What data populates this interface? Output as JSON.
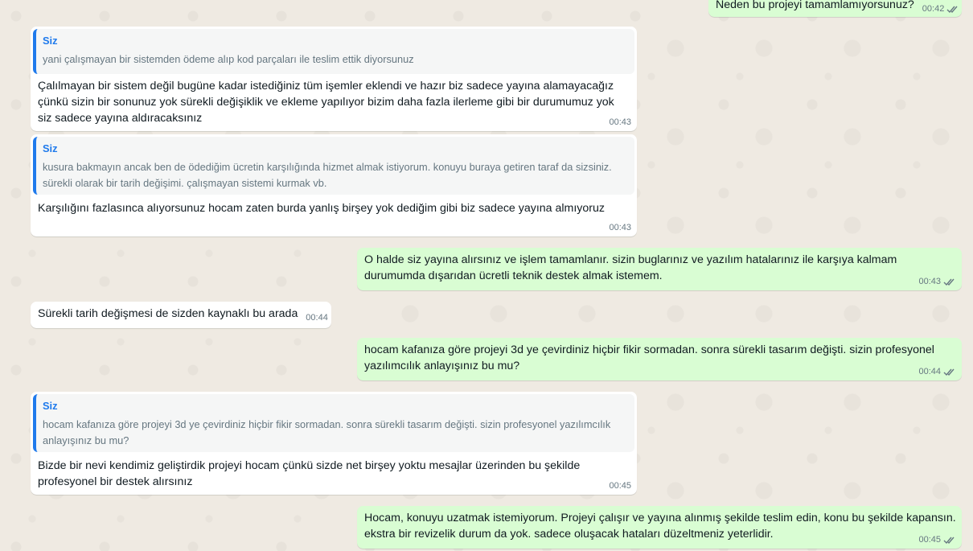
{
  "messages": [
    {
      "text": "Neden bu projeyi tamamlamıyorsunuz?",
      "time": "00:42"
    },
    {
      "quote_author": "Siz",
      "quote_text": "yani çalışmayan bir sistemden ödeme alıp kod parçaları ile teslim ettik diyorsunuz",
      "text": "Çalılmayan bir sistem değil bugüne kadar istediğiniz tüm işemler eklendi ve hazır biz sadece yayına alamayacağız çünkü sizin bir sonunuz yok sürekli değişiklik ve ekleme yapılıyor bizim daha fazla ilerleme gibi bir durumumuz yok siz sadece yayına aldıracaksınız",
      "time": "00:43"
    },
    {
      "quote_author": "Siz",
      "quote_text": "kusura bakmayın ancak ben de ödediğim ücretin  karşılığında hizmet almak istiyorum. konuyu buraya getiren taraf da sizsiniz. sürekli olarak bir tarih değişimi. çalışmayan sistemi kurmak vb.",
      "text": "Karşılığını fazlasınca alıyorsunuz hocam zaten burda yanlış birşey yok dediğim gibi biz sadece yayına almıyoruz",
      "time": "00:43"
    },
    {
      "text": "O halde siz yayına alırsınız ve işlem tamamlanır. sizin buglarınız ve yazılım hatalarınız ile karşıya kalmam durumumda dışarıdan ücretli teknik destek almak istemem.",
      "time": "00:43"
    },
    {
      "text": "Sürekli tarih değişmesi de sizden kaynaklı bu arada",
      "time": "00:44"
    },
    {
      "text": "hocam kafanıza göre projeyi 3d ye çevirdiniz hiçbir fikir sormadan. sonra sürekli tasarım değişti. sizin profesyonel yazılımcılık anlayışınız bu mu?",
      "time": "00:44"
    },
    {
      "quote_author": "Siz",
      "quote_text": "hocam kafanıza göre projeyi 3d ye çevirdiniz hiçbir fikir sormadan. sonra sürekli tasarım değişti. sizin profesyonel yazılımcılık anlayışınız bu mu?",
      "text": "Bizde bir nevi kendimiz geliştirdik projeyi hocam çünkü sizde net birşey yoktu mesajlar üzerinden bu şekilde profesyonel bir destek alırsınız",
      "time": "00:45"
    },
    {
      "text": "Hocam, konuyu uzatmak istemiyorum. Projeyi çalışır ve yayına alınmış şekilde teslim edin, konu bu şekilde kapansın. ekstra bir revizelik durum da yok. sadece oluşacak hataları düzeltmeniz yeterlidir.",
      "time": "00:45"
    }
  ],
  "icons": {
    "read_receipt": "double-check-icon"
  },
  "colors": {
    "incoming": "#ffffff",
    "outgoing": "#d9fdd3",
    "quote_accent": "#1f7aec",
    "background": "#efeae2"
  }
}
